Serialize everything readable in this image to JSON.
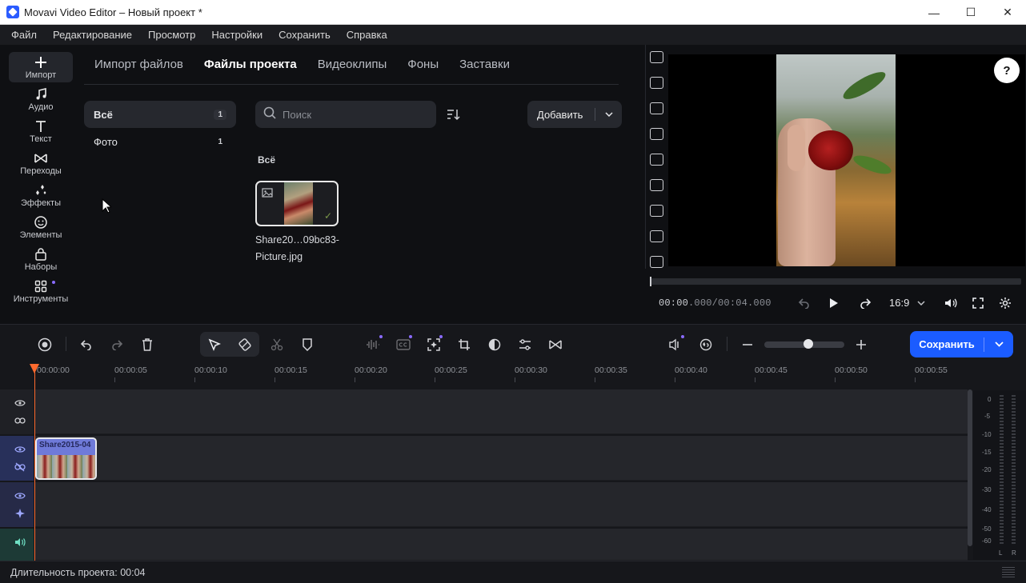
{
  "window": {
    "title": "Movavi Video Editor – Новый проект *",
    "minimize": "—",
    "maximize": "☐",
    "close": "✕"
  },
  "menu": [
    "Файл",
    "Редактирование",
    "Просмотр",
    "Настройки",
    "Сохранить",
    "Справка"
  ],
  "rail": [
    {
      "label": "Импорт",
      "icon": "plus-icon",
      "active": true
    },
    {
      "label": "Аудио",
      "icon": "music-note-icon"
    },
    {
      "label": "Текст",
      "icon": "text-t-icon"
    },
    {
      "label": "Переходы",
      "icon": "transition-bowtie-icon"
    },
    {
      "label": "Эффекты",
      "icon": "sparkle-wand-icon"
    },
    {
      "label": "Элементы",
      "icon": "smiley-icon"
    },
    {
      "label": "Наборы",
      "icon": "gift-bag-icon"
    },
    {
      "label": "Инструменты",
      "icon": "grid-tools-icon"
    }
  ],
  "import_tabs": [
    "Импорт файлов",
    "Файлы проекта",
    "Видеоклипы",
    "Фоны",
    "Заставки"
  ],
  "active_tab": "Файлы проекта",
  "categories": [
    {
      "label": "Всё",
      "count": "1",
      "active": true
    },
    {
      "label": "Фото",
      "count": "1"
    }
  ],
  "search": {
    "placeholder": "Поиск"
  },
  "add_button": {
    "label": "Добавить"
  },
  "section_title": "Всё",
  "media_item": {
    "name": "Share20…09bc83-Picture.jpg"
  },
  "preview": {
    "time_current": "00:00",
    "time_current_ms": ".000",
    "time_total": "/00:04.000",
    "ratio": "16:9",
    "help": "?"
  },
  "timeline": {
    "save_button": "Сохранить",
    "ruler_labels": [
      "00:00:00",
      "00:00:05",
      "00:00:10",
      "00:00:15",
      "00:00:20",
      "00:00:25",
      "00:00:30",
      "00:00:35",
      "00:00:40",
      "00:00:45",
      "00:00:50",
      "00:00:55"
    ],
    "clip_title": "Share2015-04",
    "zoom_level": 0.55
  },
  "meter": {
    "scale": [
      "0",
      "-5",
      "-10",
      "-15",
      "-20",
      "-30",
      "-40",
      "-50",
      "-60"
    ],
    "channels": [
      "L",
      "R"
    ]
  },
  "status": {
    "duration_label": "Длительность проекта: 00:04"
  },
  "colors": {
    "accent": "#1b5cff",
    "playhead": "#ff6a2e",
    "clip": "#6f7ad9"
  }
}
